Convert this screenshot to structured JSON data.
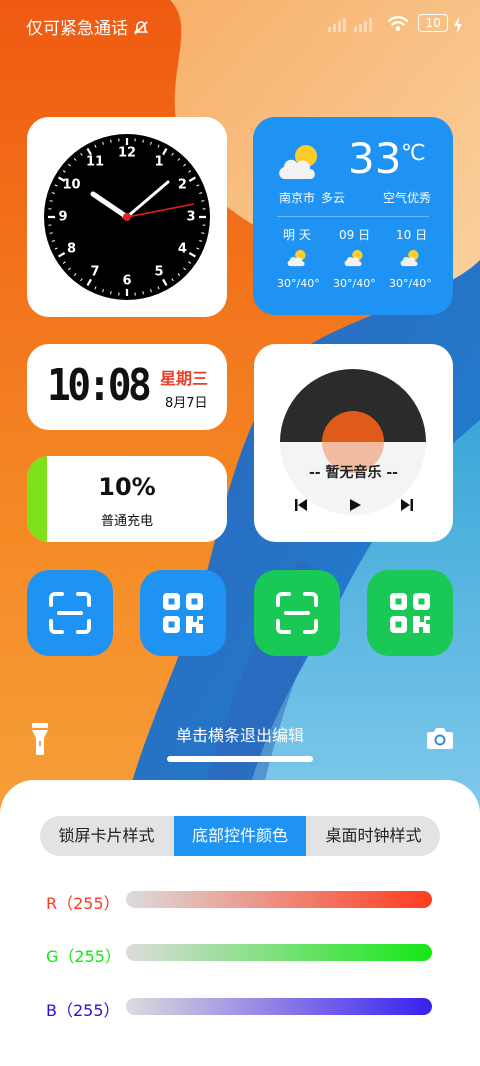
{
  "status_bar": {
    "carrier": "仅可紧急通话",
    "battery": "10"
  },
  "clock_widget": {
    "numbers": [
      "12",
      "1",
      "2",
      "3",
      "4",
      "5",
      "6",
      "7",
      "8",
      "9",
      "10",
      "11"
    ]
  },
  "weather_widget": {
    "temperature": "33",
    "unit": "℃",
    "city": "南京市",
    "condition": "多云",
    "air_quality": "空气优秀",
    "forecast": [
      {
        "day": "明 天",
        "range": "30°/40°"
      },
      {
        "day": "09 日",
        "range": "30°/40°"
      },
      {
        "day": "10 日",
        "range": "30°/40°"
      }
    ]
  },
  "digital_clock": {
    "time": "10:08",
    "weekday": "星期三",
    "date": "8月7日"
  },
  "music_widget": {
    "title": "-- 暂无音乐 --"
  },
  "battery_widget": {
    "percent": "10%",
    "status": "普通充电",
    "level": 0.1
  },
  "shortcuts": [
    {
      "icon": "scan-icon",
      "color": "#1e93f3"
    },
    {
      "icon": "qr-code-icon",
      "color": "#1e93f3"
    },
    {
      "icon": "scan-icon",
      "color": "#19c855"
    },
    {
      "icon": "qr-code-icon",
      "color": "#19c855"
    }
  ],
  "bottom_bar": {
    "hint": "单击横条退出编辑"
  },
  "settings_sheet": {
    "tabs": [
      "锁屏卡片样式",
      "底部控件颜色",
      "桌面时钟样式"
    ],
    "selected_tab": 1,
    "sliders": [
      {
        "label": "R（255）",
        "value": 255,
        "color": "#ff3b1f"
      },
      {
        "label": "G（255）",
        "value": 255,
        "color": "#16e616"
      },
      {
        "label": "B（255）",
        "value": 255,
        "color": "#3a1ff0"
      }
    ]
  }
}
